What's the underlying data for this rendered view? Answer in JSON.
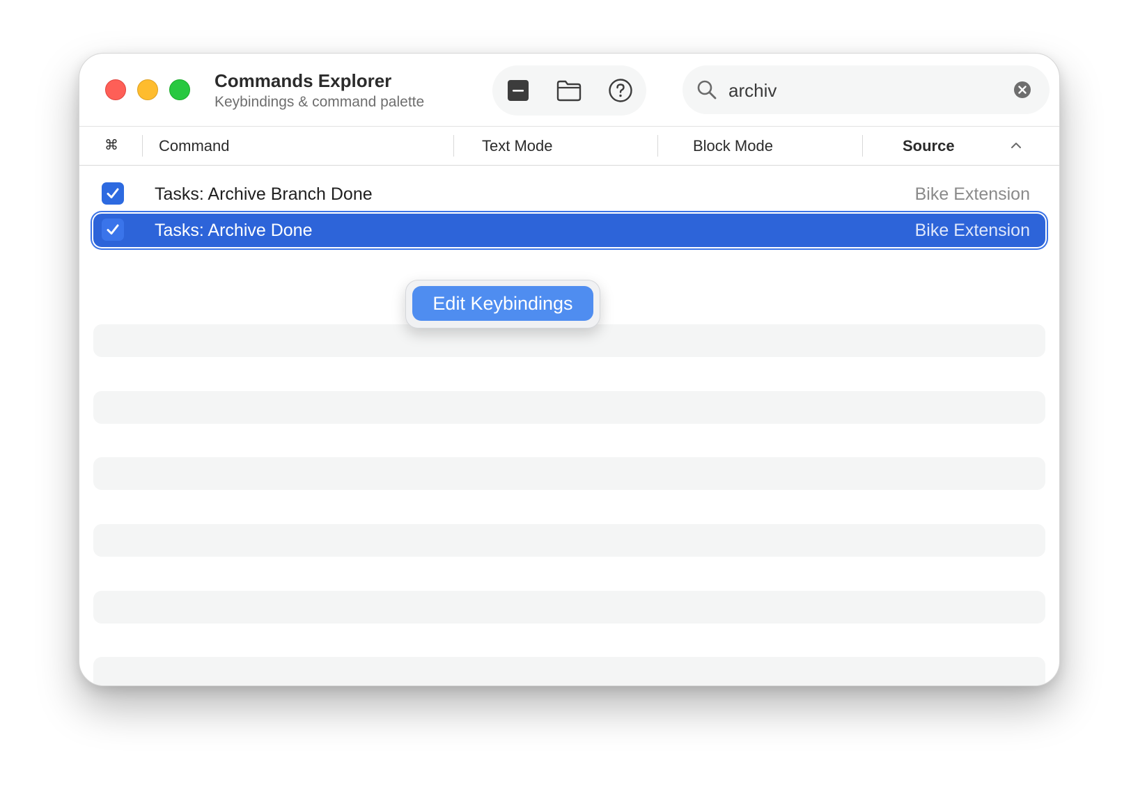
{
  "window": {
    "title": "Commands Explorer",
    "subtitle": "Keybindings & command palette"
  },
  "toolbar": {
    "icons": [
      "minus-square-icon",
      "folder-icon",
      "help-circle-icon"
    ]
  },
  "search": {
    "value": "archiv",
    "placeholder": "Search"
  },
  "table": {
    "columns": {
      "key_symbol": "⌘",
      "command": "Command",
      "text_mode": "Text Mode",
      "block_mode": "Block Mode",
      "source": "Source"
    },
    "sorted_column": "Source",
    "rows": [
      {
        "checked": true,
        "command": "Tasks: Archive Branch Done",
        "text_mode": "",
        "block_mode": "",
        "source": "Bike Extension",
        "selected": false
      },
      {
        "checked": true,
        "command": "Tasks: Archive Done",
        "text_mode": "",
        "block_mode": "",
        "source": "Bike Extension",
        "selected": true
      }
    ]
  },
  "popup": {
    "item_label": "Edit Keybindings"
  },
  "colors": {
    "selection": "#2d64d9",
    "checkbox": "#2d6ae0",
    "popup_item": "#4f8df0"
  }
}
